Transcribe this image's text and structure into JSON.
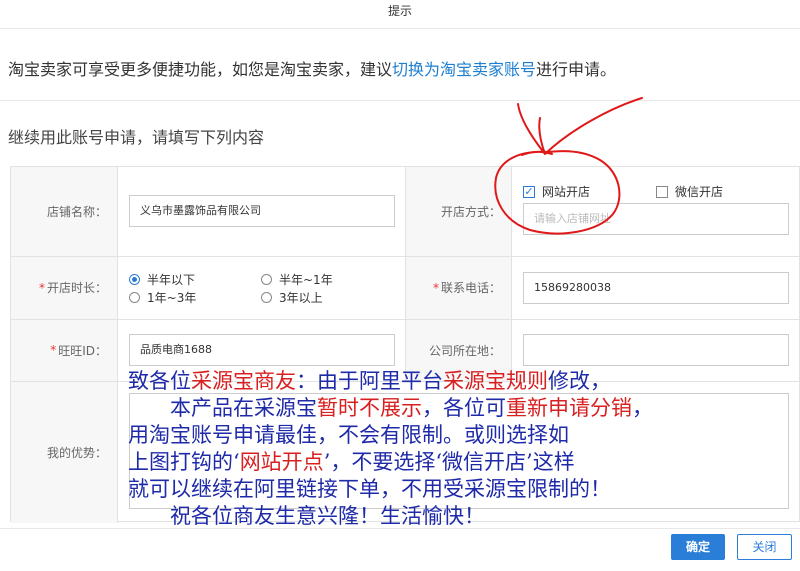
{
  "dialog": {
    "title": "提示"
  },
  "notice": {
    "prefix": "淘宝卖家可享受更多便捷功能，如您是淘宝卖家，建议",
    "link": "切换为淘宝卖家账号",
    "suffix": "进行申请。"
  },
  "subheading": "继续用此账号申请，请填写下列内容",
  "form": {
    "store_name": {
      "label": "店铺名称：",
      "value": "义乌市墨露饰品有限公司"
    },
    "open_method": {
      "label": "开店方式：",
      "options": [
        {
          "label": "网站开店",
          "checked": true
        },
        {
          "label": "微信开店",
          "checked": false
        }
      ],
      "input_placeholder": "请输入店铺网址"
    },
    "duration": {
      "required_mark": "*",
      "label": "开店时长：",
      "options": [
        {
          "label": "半年以下",
          "selected": true
        },
        {
          "label": "半年~1年",
          "selected": false
        },
        {
          "label": "1年~3年",
          "selected": false
        },
        {
          "label": "3年以上",
          "selected": false
        }
      ]
    },
    "phone": {
      "required_mark": "*",
      "label": "联系电话：",
      "value": "15869280038"
    },
    "wangwang": {
      "required_mark": "*",
      "label": "旺旺ID：",
      "value": "品质电商1688"
    },
    "company_location": {
      "label": "公司所在地：",
      "value": ""
    },
    "advantages": {
      "label": "我的优势："
    }
  },
  "overlay": {
    "l1": {
      "a": "致各位",
      "b": "采源宝商友",
      "c": "：由于阿里平台",
      "d": "采源宝规则",
      "e": "修改，"
    },
    "l2": {
      "a": "本产品在采源宝",
      "b": "暂时不展示",
      "c": "，各位可",
      "d": "重新申请分销",
      "e": "，"
    },
    "l3": "用淘宝账号申请最佳，不会有限制。或则选择如",
    "l4": {
      "a": "上图打钩的‘",
      "b": "网站开点",
      "c": "’，不要选择‘微信开店’这样"
    },
    "l5": "就可以继续在阿里链接下单，不用受采源宝限制的！",
    "l6": "祝各位商友生意兴隆！生活愉快！"
  },
  "buttons": {
    "confirm": "确定",
    "close": "关闭"
  },
  "colors": {
    "accent": "#2a7ed8",
    "link": "#1e7fd0",
    "annotation_red": "#d82020",
    "annotation_blue": "#1e2aa8"
  }
}
